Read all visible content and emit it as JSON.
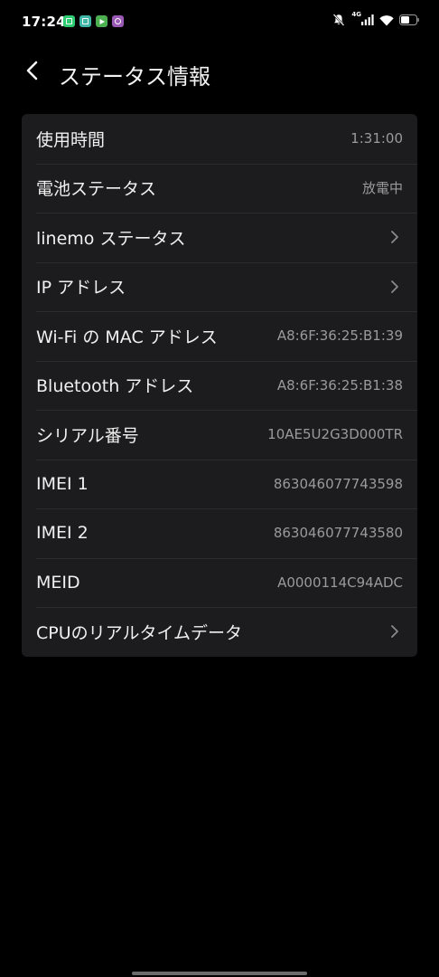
{
  "status_bar": {
    "time": "17:24",
    "network": "4G",
    "notification_icons": [
      {
        "name": "app-green-icon",
        "color": "#2ecc71"
      },
      {
        "name": "app-teal-icon",
        "color": "#3fb6a8"
      },
      {
        "name": "play-store-icon",
        "color": "#4caf50"
      },
      {
        "name": "app-purple-icon",
        "color": "#9b59b6"
      }
    ]
  },
  "header": {
    "title": "ステータス情報"
  },
  "rows": [
    {
      "label": "使用時間",
      "value": "1:31:00",
      "chevron": false
    },
    {
      "label": "電池ステータス",
      "value": "放電中",
      "chevron": false
    },
    {
      "label": "linemo ステータス",
      "value": "",
      "chevron": true
    },
    {
      "label": "IP アドレス",
      "value": "",
      "chevron": true
    },
    {
      "label": "Wi-Fi の MAC アドレス",
      "value": "A8:6F:36:25:B1:39",
      "chevron": false
    },
    {
      "label": "Bluetooth アドレス",
      "value": "A8:6F:36:25:B1:38",
      "chevron": false
    },
    {
      "label": "シリアル番号",
      "value": "10AE5U2G3D000TR",
      "chevron": false
    },
    {
      "label": "IMEI 1",
      "value": "863046077743598",
      "chevron": false
    },
    {
      "label": "IMEI 2",
      "value": "863046077743580",
      "chevron": false
    },
    {
      "label": "MEID",
      "value": "A0000114C94ADC",
      "chevron": false
    },
    {
      "label": "CPUのリアルタイムデータ",
      "value": "",
      "chevron": true
    }
  ],
  "colors": {
    "background": "#000000",
    "card": "#1c1c1e",
    "divider": "#2c2c2e",
    "label": "#f0f0f0",
    "value": "#9a9a9a"
  }
}
